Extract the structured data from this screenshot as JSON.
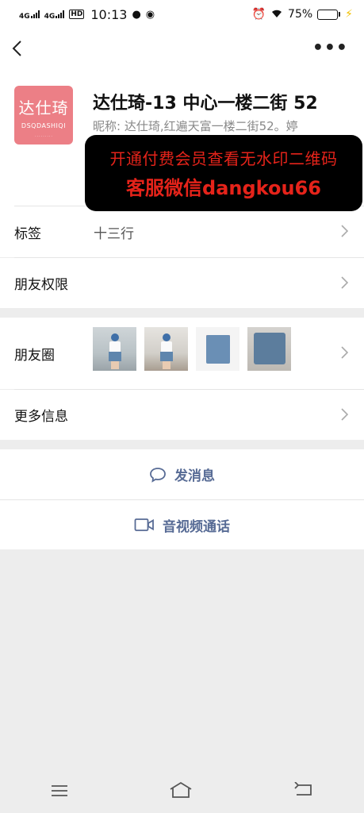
{
  "status": {
    "sim1": "4G",
    "sim2": "4G",
    "hd": "HD",
    "time": "10:13",
    "battery_percent": "75%",
    "battery_level": 0.75
  },
  "contact": {
    "avatar_text": "达仕琦",
    "avatar_sub": "DSQDASHIQI",
    "name": "达仕琦-13 中心一楼二街 52",
    "nickname": "昵称: 达仕琦,红遍天富一楼二街52。婷"
  },
  "watermark": {
    "line1": "开通付费会员查看无水印二维码",
    "line2": "客服微信dangkou66"
  },
  "rows": {
    "tags_label": "标签",
    "tags_value": "十三行",
    "friend_perm_label": "朋友权限",
    "moments_label": "朋友圈",
    "more_info_label": "更多信息"
  },
  "actions": {
    "send_message": "发消息",
    "av_call": "音视频通话"
  },
  "colors": {
    "link": "#576b95",
    "watermark_text": "#e5231a",
    "avatar_bg": "#ec7f86"
  }
}
